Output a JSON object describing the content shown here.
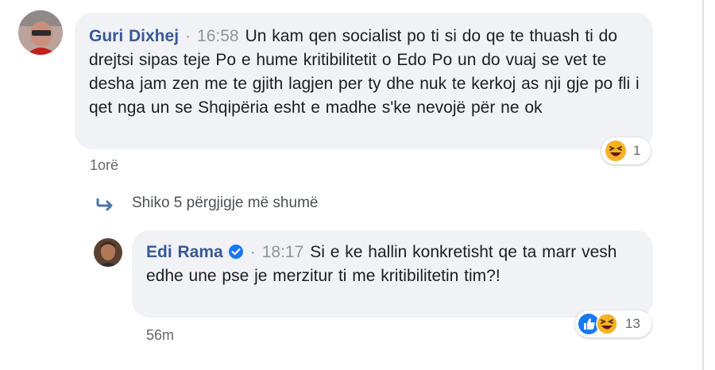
{
  "comments": [
    {
      "author": "Guri Dixhej",
      "time": "16:58",
      "text": "Un kam qen socialist po ti si do qe te thuash ti do drejtsi sipas teje Po e hume kritibilitetit o Edo Po un do vuaj se vet te desha jam zen me te gjith lagjen per ty dhe nuk te kerkoj as nji gje po fli i qet nga un se Shqipëria esht e madhe s'ke nevojë për ne ok",
      "age": "1orë",
      "reactions": {
        "icons": [
          "haha-icon"
        ],
        "count": "1"
      }
    },
    {
      "author": "Edi Rama",
      "verified": true,
      "time": "18:17",
      "text": "Si e ke hallin konkretisht qe ta marr vesh edhe une pse je merzitur ti me kritibilitetin tim?!",
      "age": "56m",
      "reactions": {
        "icons": [
          "like-icon",
          "haha-icon"
        ],
        "count": "13"
      }
    }
  ],
  "more_replies": {
    "label": "Shiko 5 përgjigje më shumë",
    "icon": "reply-arrow-icon"
  },
  "colors": {
    "bubble": "#f0f2f5",
    "author": "#385898",
    "muted": "#90949c",
    "like": "#1877f2",
    "haha": "#f7b125"
  }
}
